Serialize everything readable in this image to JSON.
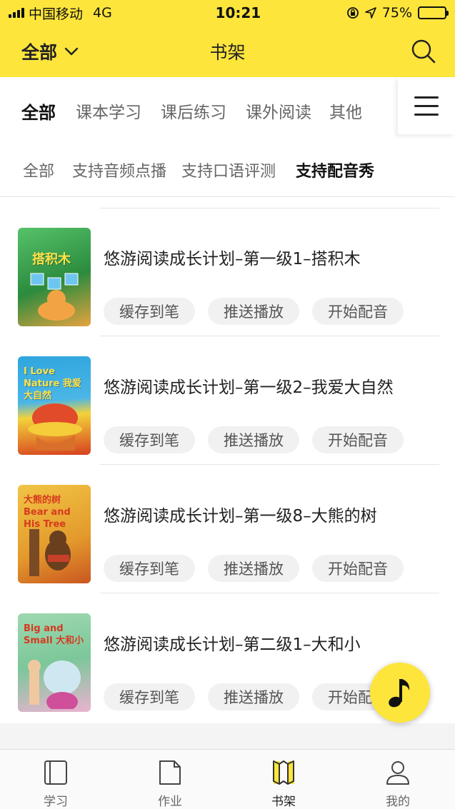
{
  "status_bar": {
    "carrier": "中国移动",
    "network": "4G",
    "time": "10:21",
    "battery": "75%",
    "battery_level": 0.75
  },
  "nav": {
    "filter_label": "全部",
    "title": "书架",
    "search_icon": "search-icon"
  },
  "category_tabs": [
    {
      "label": "全部",
      "active": true
    },
    {
      "label": "课本学习",
      "active": false
    },
    {
      "label": "课后练习",
      "active": false
    },
    {
      "label": "课外阅读",
      "active": false
    },
    {
      "label": "其他",
      "active": false
    }
  ],
  "filter_tabs": [
    {
      "label": "全部",
      "active": false
    },
    {
      "label": "支持音频点播",
      "active": false
    },
    {
      "label": "支持口语评测",
      "active": false
    },
    {
      "label": "支持配音秀",
      "active": true
    }
  ],
  "books": [
    {
      "title": "悠游阅读成长计划–第一级1–搭积木",
      "cover_text": "搭积木",
      "cover_color": "#3fa24a"
    },
    {
      "title": "悠游阅读成长计划–第一级2–我爱大自然",
      "cover_text": "I Love Nature 我爱大自然",
      "cover_color": "#2fa6de"
    },
    {
      "title": "悠游阅读成长计划–第一级8–大熊的树",
      "cover_text": "大熊的树 Bear and His Tree",
      "cover_color": "#e8a33a"
    },
    {
      "title": "悠游阅读成长计划–第二级1–大和小",
      "cover_text": "Big and Small 大和小",
      "cover_color": "#8fd1a8"
    }
  ],
  "actions": {
    "cache": "缓存到笔",
    "push": "推送播放",
    "dub": "开始配音"
  },
  "tab_bar": [
    {
      "label": "学习",
      "icon": "book-icon",
      "active": false
    },
    {
      "label": "作业",
      "icon": "document-icon",
      "active": false
    },
    {
      "label": "书架",
      "icon": "bookshelf-icon",
      "active": true
    },
    {
      "label": "我的",
      "icon": "profile-icon",
      "active": false
    }
  ],
  "colors": {
    "accent": "#fde53c",
    "accent_dark": "#f5d21b",
    "text": "#222222",
    "muted": "#666666"
  }
}
